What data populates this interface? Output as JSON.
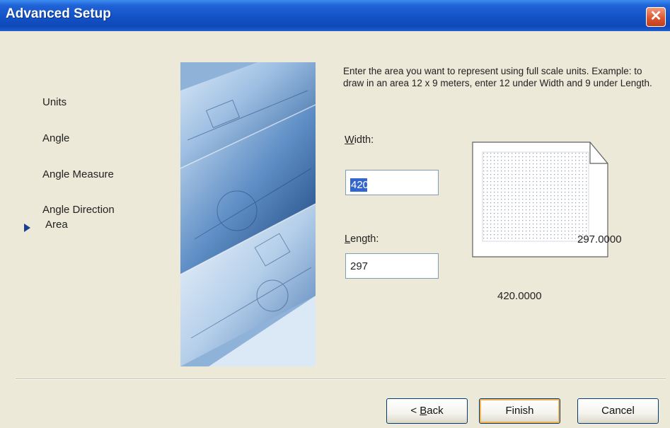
{
  "window": {
    "title": "Advanced Setup",
    "close_glyph": "✕"
  },
  "steps": [
    {
      "label": "Units",
      "current": false
    },
    {
      "label": "Angle",
      "current": false
    },
    {
      "label": "Angle Measure",
      "current": false
    },
    {
      "label": "Angle Direction",
      "current": false
    },
    {
      "label": "Area",
      "current": true
    }
  ],
  "description": "Enter the area you want to represent using full scale units.  Example: to draw in an area 12 x 9 meters, enter 12 under Width and 9 under Length.",
  "width_field": {
    "label_accel": "W",
    "label_rest": "idth:",
    "value": "420"
  },
  "length_field": {
    "label_accel": "L",
    "label_rest": "ength:",
    "value": "297"
  },
  "preview": {
    "height_readout": "297.0000",
    "width_readout": "420.0000"
  },
  "buttons": {
    "back_prefix": "< ",
    "back_accel": "B",
    "back_rest": "ack",
    "finish": "Finish",
    "cancel": "Cancel"
  },
  "colors": {
    "title_bar": "#1352c6",
    "close_button": "#d9532d",
    "dialog_bg": "#ece9d8",
    "default_button_focus": "#f5b358",
    "current_step_arrow": "#1a3f8f"
  }
}
